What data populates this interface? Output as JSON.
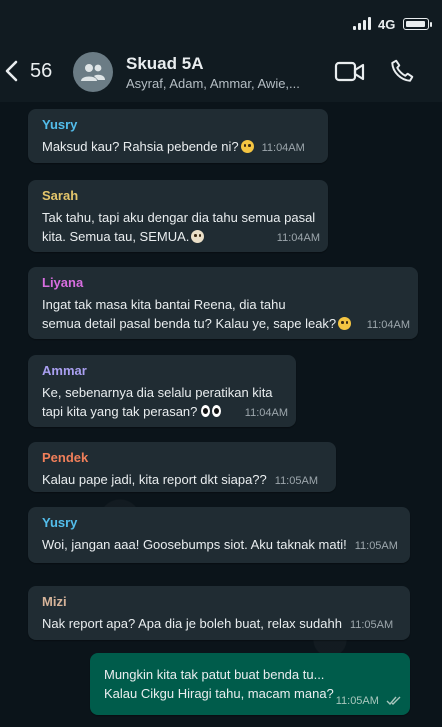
{
  "status_bar": {
    "network": "4G"
  },
  "header": {
    "back_count": "56",
    "title": "Skuad 5A",
    "members": "Asyraf, Adam, Ammar, Awie,..."
  },
  "colors": {
    "background": "#0b141a",
    "header": "#111b21",
    "incoming_bubble": "#202c33",
    "outgoing_bubble": "#005c4b"
  },
  "messages": [
    {
      "sender": "Yusry",
      "sender_color": "#53bdeb",
      "lines": [
        "Maksud kau? Rahsia pebende ni?"
      ],
      "emoji": "flushed-face",
      "time": "11:04AM"
    },
    {
      "sender": "Sarah",
      "sender_color": "#e3c56b",
      "lines": [
        "Tak tahu, tapi aku dengar dia tahu semua pasal",
        "kita. Semua tau, SEMUA."
      ],
      "emoji": "fearful-face",
      "time": "11:04AM"
    },
    {
      "sender": "Liyana",
      "sender_color": "#d86ee0",
      "lines": [
        "Ingat tak masa kita bantai Reena, dia tahu",
        "semua detail pasal benda tu? Kalau ye, sape leak?"
      ],
      "emoji": "smiling-face",
      "time": "11:04AM"
    },
    {
      "sender": "Ammar",
      "sender_color": "#a99ff0",
      "lines": [
        "Ke, sebenarnya dia selalu peratikan kita",
        "tapi kita yang tak perasan?"
      ],
      "emoji": "eyes",
      "time": "11:04AM"
    },
    {
      "sender": "Pendek",
      "sender_color": "#f07f5a",
      "lines": [
        "Kalau pape jadi, kita report dkt siapa??"
      ],
      "time": "11:05AM"
    },
    {
      "sender": "Yusry",
      "sender_color": "#53bdeb",
      "lines": [
        "Woi, jangan aaa! Goosebumps siot. Aku taknak mati!"
      ],
      "time": "11:05AM"
    },
    {
      "sender": "Mizi",
      "sender_color": "#d6b49a",
      "lines": [
        "Nak report apa? Apa dia je boleh buat, relax sudahh"
      ],
      "time": "11:05AM"
    },
    {
      "outgoing": true,
      "lines": [
        "Mungkin kita tak patut buat benda tu...",
        "Kalau Cikgu Hiragi tahu, macam mana?"
      ],
      "time": "11:05AM",
      "status": "read"
    }
  ]
}
